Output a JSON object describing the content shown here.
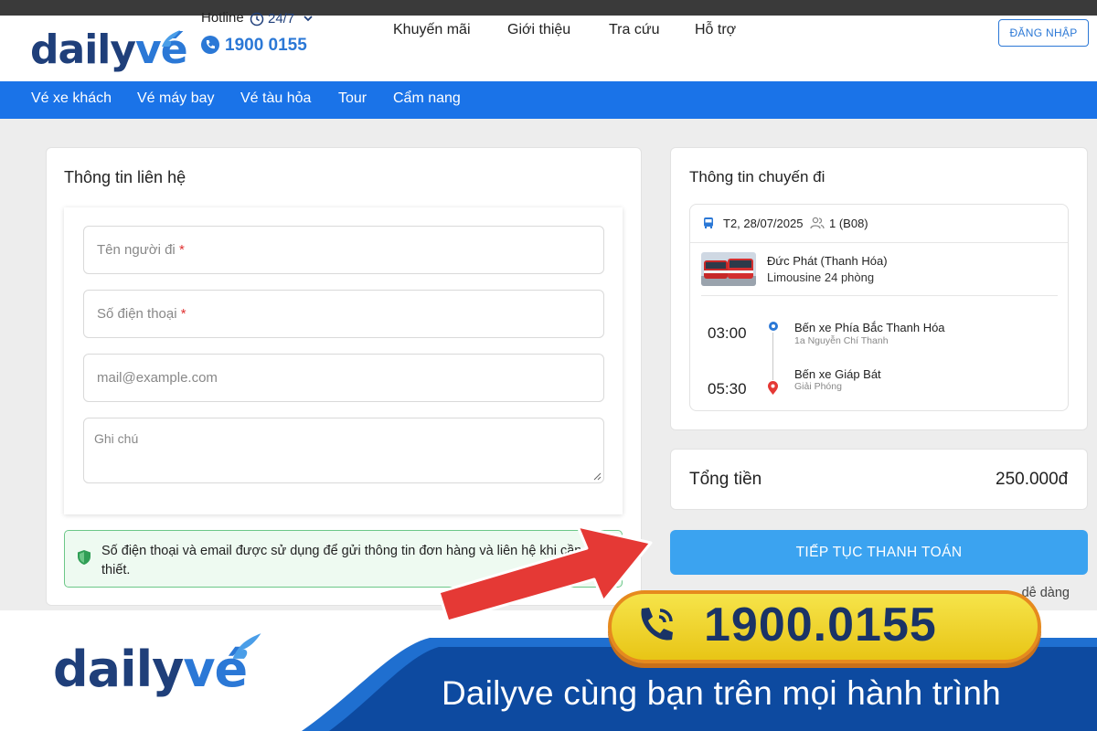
{
  "header": {
    "logo": {
      "part1": "daily",
      "part2": "vé"
    },
    "hotline_label": "Hotline",
    "hotline_hours": "24/7",
    "hotline_number": "1900 0155",
    "nav": [
      "Khuyến mãi",
      "Giới thiệu",
      "Tra cứu",
      "Hỗ trợ"
    ],
    "login_label": "ĐĂNG NHẬP"
  },
  "category_nav": [
    "Vé xe khách",
    "Vé máy bay",
    "Vé tàu hỏa",
    "Tour",
    "Cẩm nang"
  ],
  "contact": {
    "title": "Thông tin liên hệ",
    "name_placeholder": "Tên người đi",
    "phone_placeholder": "Số điện thoại",
    "required_mark": "*",
    "email_placeholder": "mail@example.com",
    "note_placeholder": "Ghi chú",
    "notice": "Số điện thoại và email được sử dụng để gửi thông tin đơn hàng và liên hệ khi cần thiết."
  },
  "trip": {
    "title": "Thông tin chuyến đi",
    "date": "T2, 28/07/2025",
    "seats": "1 (B08)",
    "operator": "Đức Phát (Thanh Hóa)",
    "vehicle": "Limousine 24 phòng",
    "departure": {
      "time": "03:00",
      "station": "Bến xe Phía Bắc Thanh Hóa",
      "address": "1a Nguyễn Chí Thanh"
    },
    "arrival": {
      "time": "05:30",
      "station": "Bến xe Giáp Bát",
      "address": "Giải Phóng"
    }
  },
  "total": {
    "label": "Tổng tiền",
    "value": "250.000đ"
  },
  "pay_button": "TIẾP TỤC THANH TOÁN",
  "partial_text": "dễ dàng",
  "banner": {
    "phone": "1900.0155",
    "logo": {
      "part1": "daily",
      "part2": "vé"
    },
    "slogan": "Dailyve cùng bạn trên mọi hành trình"
  },
  "colors": {
    "brand_blue": "#1a73e8",
    "navy": "#1f3f7a",
    "button_blue": "#3ba3f0",
    "arrow_red": "#e53935",
    "notice_green": "#6cc788"
  }
}
